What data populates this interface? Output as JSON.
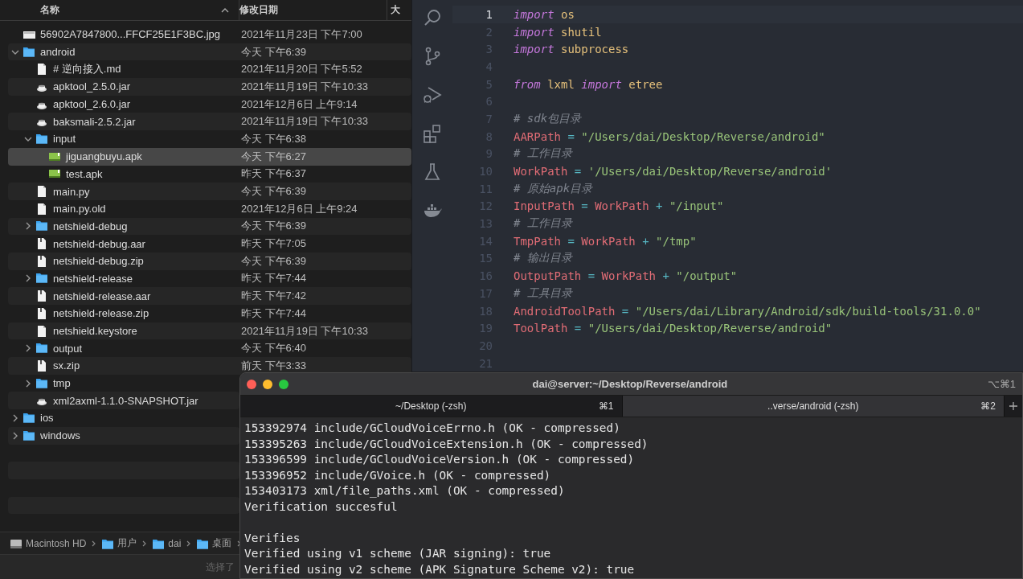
{
  "finder": {
    "columns": [
      {
        "label": "名称",
        "sorted": true
      },
      {
        "label": "修改日期",
        "sorted": false
      },
      {
        "label": "大",
        "sorted": false
      }
    ],
    "rows": [
      {
        "kind": "image",
        "name": "56902A7847800...FFCF25E1F3BC.jpg",
        "date": "2021年11月23日 下午7:00",
        "selected": false
      },
      {
        "kind": "folder",
        "name": "android",
        "date": "今天 下午6:39",
        "expanded": true,
        "selected": false,
        "children": [
          {
            "kind": "document",
            "name": "# 逆向接入.md",
            "date": "2021年11月20日 下午5:52",
            "selected": false
          },
          {
            "kind": "jar",
            "name": "apktool_2.5.0.jar",
            "date": "2021年11月19日 下午10:33",
            "selected": false
          },
          {
            "kind": "jar",
            "name": "apktool_2.6.0.jar",
            "date": "2021年12月6日 上午9:14",
            "selected": false
          },
          {
            "kind": "jar",
            "name": "baksmali-2.5.2.jar",
            "date": "2021年11月19日 下午10:33",
            "selected": false
          },
          {
            "kind": "folder",
            "name": "input",
            "date": "今天 下午6:38",
            "expanded": true,
            "selected": false,
            "children": [
              {
                "kind": "apk",
                "name": "jiguangbuyu.apk",
                "date": "今天 下午6:27",
                "selected": true
              },
              {
                "kind": "apk",
                "name": "test.apk",
                "date": "昨天 下午6:37",
                "selected": false
              }
            ]
          },
          {
            "kind": "document",
            "name": "main.py",
            "date": "今天 下午6:39",
            "selected": false
          },
          {
            "kind": "document",
            "name": "main.py.old",
            "date": "2021年12月6日 上午9:24",
            "selected": false
          },
          {
            "kind": "folder",
            "name": "netshield-debug",
            "date": "今天 下午6:39",
            "expanded": false,
            "selected": false
          },
          {
            "kind": "archive",
            "name": "netshield-debug.aar",
            "date": "昨天 下午7:05",
            "selected": false
          },
          {
            "kind": "archive",
            "name": "netshield-debug.zip",
            "date": "今天 下午6:39",
            "selected": false
          },
          {
            "kind": "folder",
            "name": "netshield-release",
            "date": "昨天 下午7:44",
            "expanded": false,
            "selected": false
          },
          {
            "kind": "archive",
            "name": "netshield-release.aar",
            "date": "昨天 下午7:42",
            "selected": false
          },
          {
            "kind": "archive",
            "name": "netshield-release.zip",
            "date": "昨天 下午7:44",
            "selected": false
          },
          {
            "kind": "document",
            "name": "netshield.keystore",
            "date": "2021年11月19日 下午10:33",
            "selected": false
          },
          {
            "kind": "folder",
            "name": "output",
            "date": "今天 下午6:40",
            "expanded": false,
            "selected": false
          },
          {
            "kind": "archive",
            "name": "sx.zip",
            "date": "前天 下午3:33",
            "selected": false
          },
          {
            "kind": "folder",
            "name": "tmp",
            "expanded": false,
            "selected": false
          },
          {
            "kind": "jar",
            "name": "xml2axml-1.1.0-SNAPSHOT.jar",
            "selected": false
          }
        ]
      },
      {
        "kind": "folder",
        "name": "ios",
        "expanded": false,
        "selected": false
      },
      {
        "kind": "folder",
        "name": "windows",
        "expanded": false,
        "selected": false
      }
    ],
    "path_bar": [
      {
        "kind": "disk",
        "label": "Macintosh HD"
      },
      {
        "kind": "folder",
        "label": "用户"
      },
      {
        "kind": "folder",
        "label": "dai"
      },
      {
        "kind": "folder",
        "label": "桌面"
      }
    ],
    "status_bar": "选择了"
  },
  "editor": {
    "activity_bar": [
      {
        "kind": "search"
      },
      {
        "kind": "branch"
      },
      {
        "kind": "debug"
      },
      {
        "kind": "extensions"
      },
      {
        "kind": "flask"
      },
      {
        "kind": "whale"
      }
    ],
    "lines": [
      {
        "number": "1",
        "current": true,
        "tokens": [
          {
            "kind": "keyword",
            "text": "import"
          },
          {
            "kind": "module",
            "text": " os"
          }
        ]
      },
      {
        "number": "2",
        "current": false,
        "tokens": [
          {
            "kind": "keyword",
            "text": "import"
          },
          {
            "kind": "module",
            "text": " shutil"
          }
        ]
      },
      {
        "number": "3",
        "current": false,
        "tokens": [
          {
            "kind": "keyword",
            "text": "import"
          },
          {
            "kind": "module",
            "text": " subprocess"
          }
        ]
      },
      {
        "number": "4",
        "current": false
      },
      {
        "number": "5",
        "current": false,
        "tokens": [
          {
            "kind": "keyword",
            "text": "from"
          },
          {
            "kind": "module",
            "text": " lxml "
          },
          {
            "kind": "keyword",
            "text": "import"
          },
          {
            "kind": "module",
            "text": " etree"
          }
        ]
      },
      {
        "number": "6",
        "current": false
      },
      {
        "number": "7",
        "current": false,
        "tokens": [
          {
            "kind": "comment",
            "text": "# sdk包目录"
          }
        ]
      },
      {
        "number": "8",
        "current": false,
        "tokens": [
          {
            "kind": "variable",
            "text": "AARPath"
          },
          {
            "kind": "operator",
            "text": " = "
          },
          {
            "kind": "string",
            "text": "\"/Users/dai/Desktop/Reverse/android\""
          }
        ]
      },
      {
        "number": "9",
        "current": false,
        "tokens": [
          {
            "kind": "comment",
            "text": "# 工作目录"
          }
        ]
      },
      {
        "number": "10",
        "current": false,
        "tokens": [
          {
            "kind": "variable",
            "text": "WorkPath"
          },
          {
            "kind": "operator",
            "text": " = "
          },
          {
            "kind": "string",
            "text": "'/Users/dai/Desktop/Reverse/android'"
          }
        ]
      },
      {
        "number": "11",
        "current": false,
        "tokens": [
          {
            "kind": "comment",
            "text": "# 原始apk目录"
          }
        ]
      },
      {
        "number": "12",
        "current": false,
        "tokens": [
          {
            "kind": "variable",
            "text": "InputPath"
          },
          {
            "kind": "operator",
            "text": " = "
          },
          {
            "kind": "variable",
            "text": "WorkPath"
          },
          {
            "kind": "operator",
            "text": " + "
          },
          {
            "kind": "string",
            "text": "\"/input\""
          }
        ]
      },
      {
        "number": "13",
        "current": false,
        "tokens": [
          {
            "kind": "comment",
            "text": "# 工作目录"
          }
        ]
      },
      {
        "number": "14",
        "current": false,
        "tokens": [
          {
            "kind": "variable",
            "text": "TmpPath"
          },
          {
            "kind": "operator",
            "text": " = "
          },
          {
            "kind": "variable",
            "text": "WorkPath"
          },
          {
            "kind": "operator",
            "text": " + "
          },
          {
            "kind": "string",
            "text": "\"/tmp\""
          }
        ]
      },
      {
        "number": "15",
        "current": false,
        "tokens": [
          {
            "kind": "comment",
            "text": "# 输出目录"
          }
        ]
      },
      {
        "number": "16",
        "current": false,
        "tokens": [
          {
            "kind": "variable",
            "text": "OutputPath"
          },
          {
            "kind": "operator",
            "text": " = "
          },
          {
            "kind": "variable",
            "text": "WorkPath"
          },
          {
            "kind": "operator",
            "text": " + "
          },
          {
            "kind": "string",
            "text": "\"/output\""
          }
        ]
      },
      {
        "number": "17",
        "current": false,
        "tokens": [
          {
            "kind": "comment",
            "text": "# 工具目录"
          }
        ]
      },
      {
        "number": "18",
        "current": false,
        "tokens": [
          {
            "kind": "variable",
            "text": "AndroidToolPath"
          },
          {
            "kind": "operator",
            "text": " = "
          },
          {
            "kind": "string",
            "text": "\"/Users/dai/Library/Android/sdk/build-tools/31.0.0\""
          }
        ]
      },
      {
        "number": "19",
        "current": false,
        "tokens": [
          {
            "kind": "variable",
            "text": "ToolPath"
          },
          {
            "kind": "operator",
            "text": " = "
          },
          {
            "kind": "string",
            "text": "\"/Users/dai/Desktop/Reverse/android\""
          }
        ]
      },
      {
        "number": "20",
        "current": false
      },
      {
        "number": "21",
        "current": false
      }
    ]
  },
  "terminal": {
    "title": "dai@server:~/Desktop/Reverse/android",
    "shortcut": "⌥⌘1",
    "tabs": [
      {
        "label": "~/Desktop (-zsh)",
        "shortcut": "⌘1",
        "selected": false
      },
      {
        "label": "..verse/android (-zsh)",
        "shortcut": "⌘2",
        "selected": true
      }
    ],
    "output_blocks": [
      [
        "153392974 include/GCloudVoiceErrno.h (OK - compressed)",
        "153395263 include/GCloudVoiceExtension.h (OK - compressed)",
        "153396599 include/GCloudVoiceVersion.h (OK - compressed)",
        "153396952 include/GVoice.h (OK - compressed)",
        "153403173 xml/file_paths.xml (OK - compressed)",
        "Verification succesful"
      ],
      [
        "Verifies",
        "Verified using v1 scheme (JAR signing): true",
        "Verified using v2 scheme (APK Signature Scheme v2): true"
      ]
    ]
  }
}
